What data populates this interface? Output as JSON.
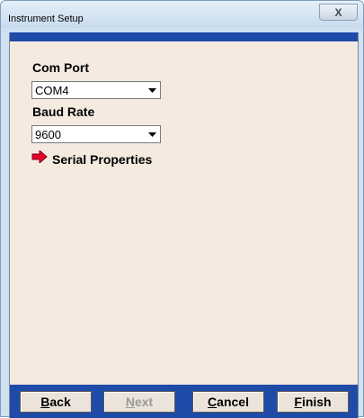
{
  "window": {
    "title": "Instrument Setup",
    "close_glyph": "X"
  },
  "com_port": {
    "label": "Com Port",
    "value": "COM4"
  },
  "baud_rate": {
    "label": "Baud Rate",
    "value": "9600"
  },
  "serial_properties": {
    "label": "Serial Properties",
    "icon": "red-arrow-icon"
  },
  "buttons": {
    "back": {
      "label": "Back",
      "mnemonic": "B",
      "rest": "ack"
    },
    "next": {
      "label": "Next",
      "mnemonic": "N",
      "rest": "ext",
      "disabled": true
    },
    "cancel": {
      "label": "Cancel",
      "mnemonic": "C",
      "rest": "ancel"
    },
    "finish": {
      "label": "Finish",
      "mnemonic": "F",
      "rest": "inish"
    }
  },
  "colors": {
    "accent": "#1f4ba8",
    "panel": "#f4eae0",
    "arrow": "#e4002b"
  }
}
